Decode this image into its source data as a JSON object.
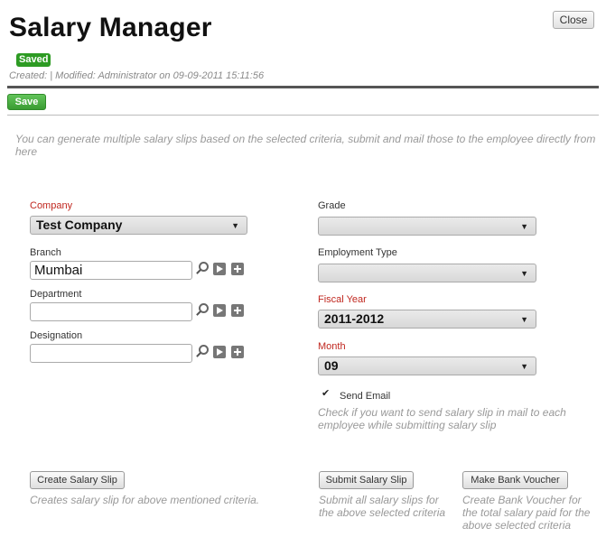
{
  "header": {
    "title": "Salary Manager",
    "close_label": "Close",
    "status_badge": "Saved",
    "meta": "Created: | Modified: Administrator on 09-09-2011 15:11:56"
  },
  "toolbar": {
    "save_label": "Save"
  },
  "intro_text": "You can generate multiple salary slips based on the selected criteria, submit and mail those to the employee directly from here",
  "form": {
    "company": {
      "label": "Company",
      "value": "Test Company"
    },
    "branch": {
      "label": "Branch",
      "value": "Mumbai"
    },
    "department": {
      "label": "Department",
      "value": ""
    },
    "designation": {
      "label": "Designation",
      "value": ""
    },
    "grade": {
      "label": "Grade",
      "value": ""
    },
    "employment_type": {
      "label": "Employment Type",
      "value": ""
    },
    "fiscal_year": {
      "label": "Fiscal Year",
      "value": "2011-2012"
    },
    "month": {
      "label": "Month",
      "value": "09"
    },
    "send_email": {
      "label": "Send Email",
      "checked": true,
      "help": "Check if you want to send salary slip in mail to each employee while submitting salary slip"
    }
  },
  "actions": {
    "create": {
      "label": "Create Salary Slip",
      "desc": "Creates salary slip for above mentioned criteria."
    },
    "submit": {
      "label": "Submit Salary Slip",
      "desc": "Submit all salary slips for the above selected criteria"
    },
    "voucher": {
      "label": "Make Bank Voucher",
      "desc": "Create Bank Voucher for the total salary paid for the above selected criteria"
    }
  },
  "icons": {
    "search": "magnifier-icon",
    "open": "play-icon",
    "new": "plus-icon",
    "dropdown": "chevron-down-icon"
  },
  "colors": {
    "required_label": "#c0271f",
    "saved_badge": "#2d9b23",
    "save_button": "#4cae44"
  }
}
